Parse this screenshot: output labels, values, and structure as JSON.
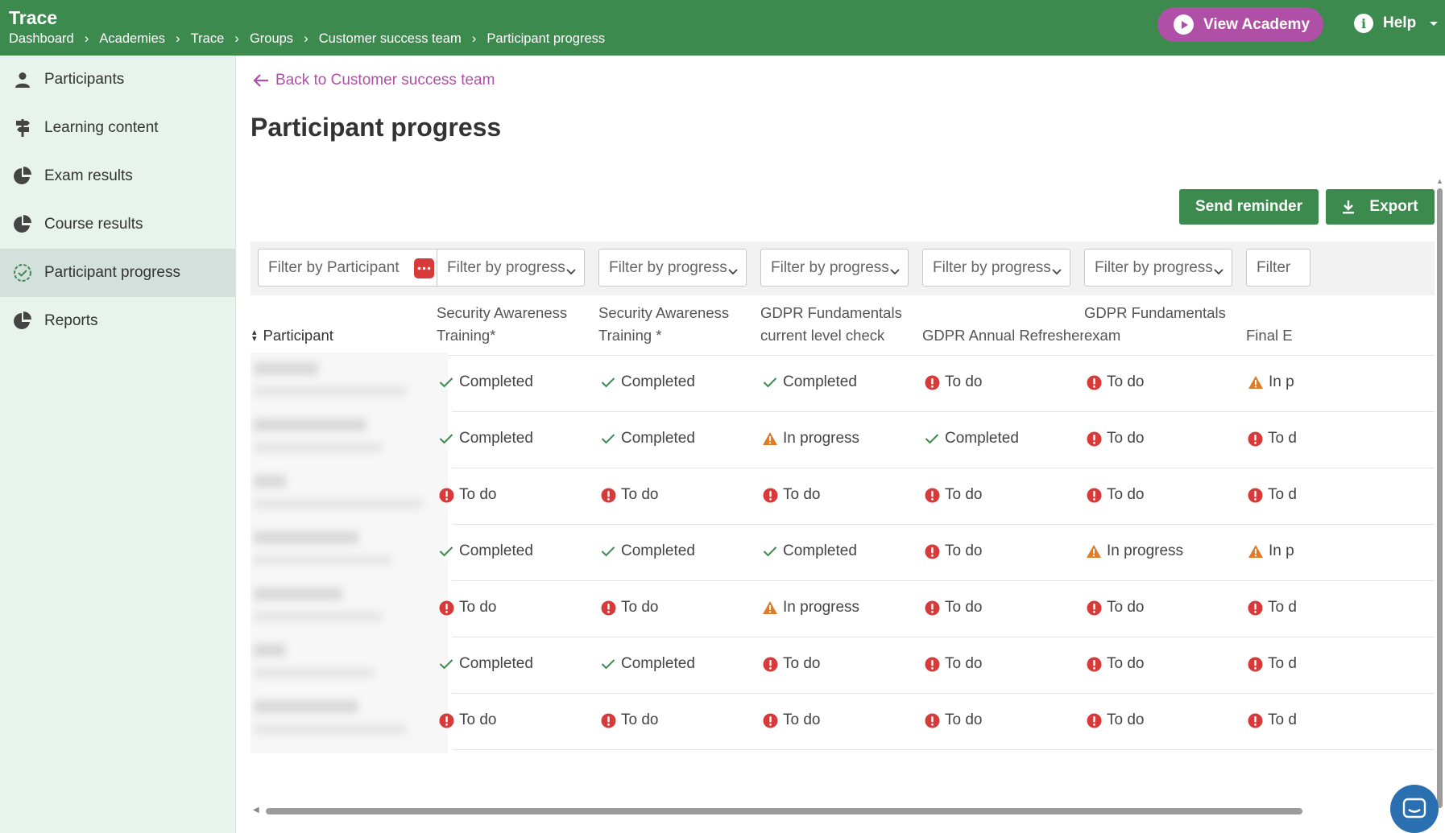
{
  "header": {
    "app_title": "Trace",
    "breadcrumb": [
      "Dashboard",
      "Academies",
      "Trace",
      "Groups",
      "Customer success team",
      "Participant progress"
    ],
    "view_academy_label": "View Academy",
    "help_label": "Help",
    "colors": {
      "brand_green": "#3d8a4f",
      "accent_purple": "#b04fa6"
    }
  },
  "sidebar": {
    "items": [
      {
        "label": "Participants",
        "icon": "person-icon",
        "active": false
      },
      {
        "label": "Learning content",
        "icon": "signpost-icon",
        "active": false
      },
      {
        "label": "Exam results",
        "icon": "pie-chart-icon",
        "active": false
      },
      {
        "label": "Course results",
        "icon": "pie-chart-icon",
        "active": false
      },
      {
        "label": "Participant progress",
        "icon": "check-circle-icon",
        "active": true
      },
      {
        "label": "Reports",
        "icon": "pie-chart-icon",
        "active": false
      }
    ]
  },
  "main": {
    "back_link": "Back to Customer success team",
    "title": "Participant progress",
    "send_reminder_label": "Send reminder",
    "export_label": "Export",
    "filters": {
      "participant_placeholder": "Filter by Participant",
      "progress_placeholder": "Filter by progress",
      "partial_placeholder": "Filter"
    },
    "table": {
      "participant_header": "Participant",
      "columns": [
        {
          "line1": "Security Awareness",
          "line2": "Training*"
        },
        {
          "line1": "Security Awareness",
          "line2": "Training *"
        },
        {
          "line1": "GDPR Fundamentals",
          "line2": "current level check"
        },
        {
          "line1": "",
          "line2": "GDPR Annual Refresher*"
        },
        {
          "line1": "GDPR Fundamentals",
          "line2": "exam"
        },
        {
          "line1": "",
          "line2": "Final E"
        }
      ],
      "rows": [
        [
          "Completed",
          "Completed",
          "Completed",
          "To do",
          "To do",
          "In p"
        ],
        [
          "Completed",
          "Completed",
          "In progress",
          "Completed",
          "To do",
          "To d"
        ],
        [
          "To do",
          "To do",
          "To do",
          "To do",
          "To do",
          "To d"
        ],
        [
          "Completed",
          "Completed",
          "Completed",
          "To do",
          "In progress",
          "In p"
        ],
        [
          "To do",
          "To do",
          "In progress",
          "To do",
          "To do",
          "To d"
        ],
        [
          "Completed",
          "Completed",
          "To do",
          "To do",
          "To do",
          "To d"
        ],
        [
          "To do",
          "To do",
          "To do",
          "To do",
          "To do",
          "To d"
        ]
      ],
      "status_colors": {
        "completed": "#3d8a4f",
        "todo": "#d83a3a",
        "in_progress": "#e07b28"
      }
    }
  }
}
